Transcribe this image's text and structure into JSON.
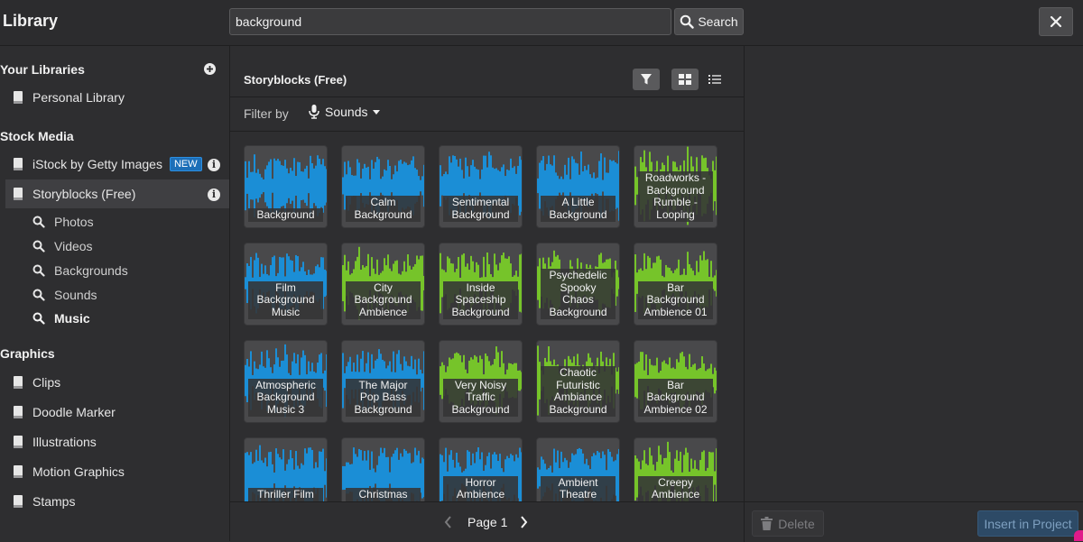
{
  "header": {
    "title": "Library",
    "search_value": "background",
    "search_button": "Search"
  },
  "sidebar": {
    "your_libraries_heading": "Your Libraries",
    "personal_library": "Personal Library",
    "stock_media_heading": "Stock Media",
    "istock": "iStock by Getty Images",
    "new_badge": "NEW",
    "storyblocks": "Storyblocks (Free)",
    "sub_items": [
      "Photos",
      "Videos",
      "Backgrounds",
      "Sounds",
      "Music"
    ],
    "graphics_heading": "Graphics",
    "graphics_items": [
      "Clips",
      "Doodle Marker",
      "Illustrations",
      "Motion Graphics",
      "Stamps"
    ]
  },
  "main": {
    "provider_title": "Storyblocks (Free)",
    "filter_label": "Filter by",
    "filter_value": "Sounds"
  },
  "colors": {
    "blue": "#1b8ed6",
    "green": "#76c42a"
  },
  "results": [
    {
      "label": "Background",
      "color": "blue"
    },
    {
      "label": "Calm\nBackground",
      "color": "blue"
    },
    {
      "label": "Sentimental\nBackground",
      "color": "blue"
    },
    {
      "label": "A Little\nBackground",
      "color": "blue"
    },
    {
      "label": "Roadworks -\nBackground\nRumble -\nLooping",
      "color": "green"
    },
    {
      "label": "Film\nBackground\nMusic",
      "color": "blue"
    },
    {
      "label": "City\nBackground\nAmbience",
      "color": "green"
    },
    {
      "label": "Inside\nSpaceship\nBackground",
      "color": "green"
    },
    {
      "label": "Psychedelic\nSpooky\nChaos\nBackground",
      "color": "green"
    },
    {
      "label": "Bar\nBackground\nAmbience 01",
      "color": "green"
    },
    {
      "label": "Atmospheric\nBackground\nMusic 3",
      "color": "blue"
    },
    {
      "label": "The Major\nPop Bass\nBackground",
      "color": "blue"
    },
    {
      "label": "Very Noisy\nTraffic\nBackground",
      "color": "green"
    },
    {
      "label": "Chaotic\nFuturistic\nAmbiance\nBackground",
      "color": "green"
    },
    {
      "label": "Bar\nBackground\nAmbience 02",
      "color": "green"
    },
    {
      "label": "Thriller Film\nBackground",
      "color": "blue"
    },
    {
      "label": "Christmas\nBackground -",
      "color": "blue"
    },
    {
      "label": "Horror\nAmbience\nBackground",
      "color": "blue"
    },
    {
      "label": "Ambient\nTheatre\nBackground",
      "color": "blue"
    },
    {
      "label": "Creepy\nAmbience\nBackground -",
      "color": "green"
    }
  ],
  "pager": {
    "label": "Page 1"
  },
  "footer": {
    "delete_label": "Delete",
    "insert_label": "Insert in Project"
  }
}
